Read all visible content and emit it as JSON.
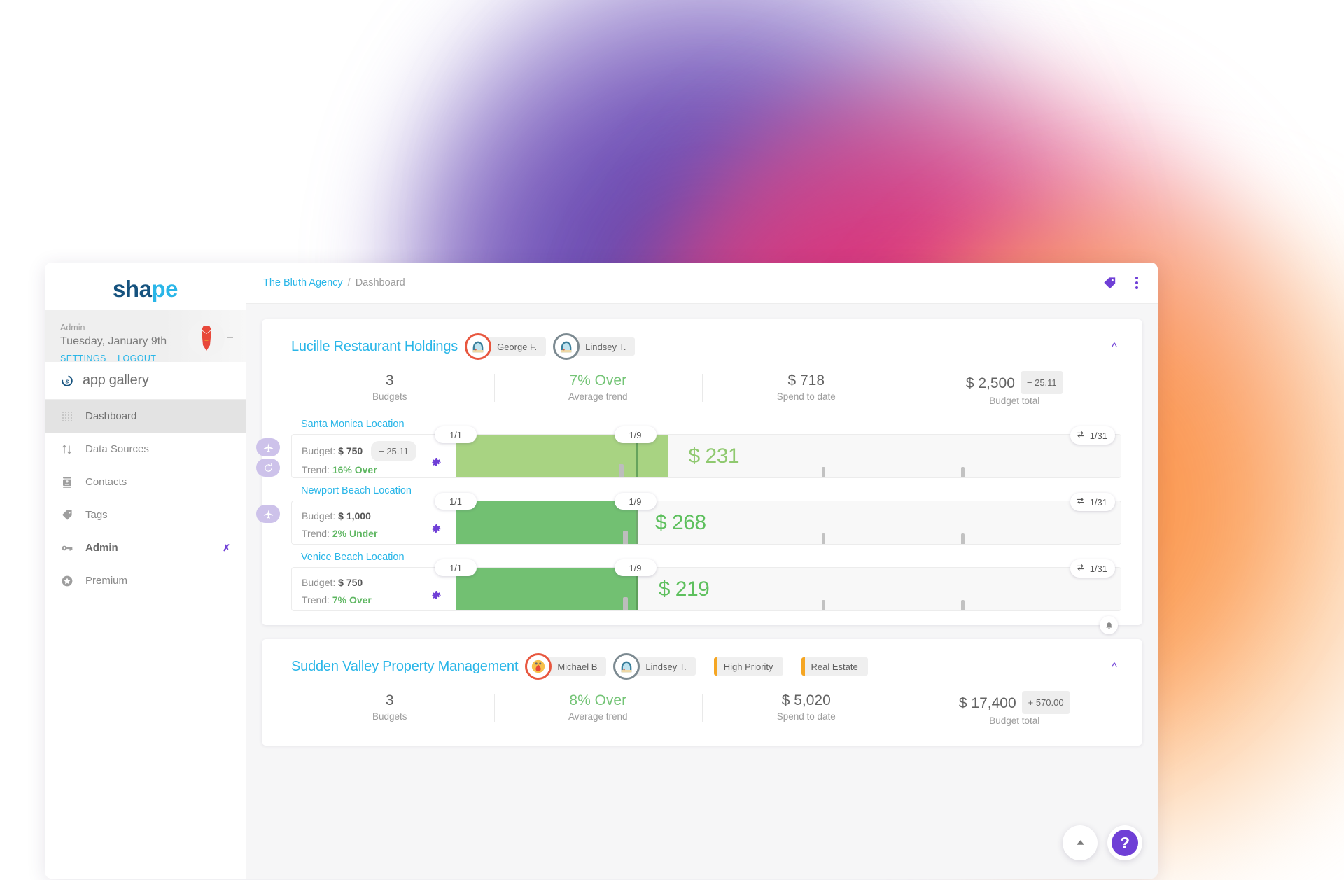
{
  "sidebar": {
    "logo": {
      "part1": "sh",
      "part2": "a",
      "part3": "pe"
    },
    "user": {
      "role": "Admin",
      "date": "Tuesday, January 9th",
      "settings_label": "SETTINGS",
      "logout_label": "LOGOUT",
      "avatar_icon": "necktie-avatar-icon"
    },
    "gallery": {
      "label": "app gallery",
      "icon": "shape-s-icon"
    },
    "items": [
      {
        "label": "Dashboard",
        "icon": "grid-dots-icon",
        "active": true,
        "bold": false,
        "chevron": false
      },
      {
        "label": "Data Sources",
        "icon": "sort-arrows-icon",
        "active": false,
        "bold": false,
        "chevron": false
      },
      {
        "label": "Contacts",
        "icon": "contact-card-icon",
        "active": false,
        "bold": false,
        "chevron": false
      },
      {
        "label": "Tags",
        "icon": "tag-icon",
        "active": false,
        "bold": false,
        "chevron": false
      },
      {
        "label": "Admin",
        "icon": "key-icon",
        "active": false,
        "bold": true,
        "chevron": true
      },
      {
        "label": "Premium",
        "icon": "star-circle-icon",
        "active": false,
        "bold": false,
        "chevron": false
      }
    ]
  },
  "topbar": {
    "breadcrumb_link": "The Bluth Agency",
    "breadcrumb_sep": "/",
    "breadcrumb_current": "Dashboard",
    "tag_icon": "tag-icon",
    "menu_icon": "kebab-menu-icon"
  },
  "colors": {
    "accent_blue": "#29b6e8",
    "accent_purple": "#6f3fd6",
    "green": "#74c476",
    "bar_light": "#a8d382",
    "bar_mid": "#72c072",
    "tag_orange": "#f5a623"
  },
  "cards": [
    {
      "title": "Lucille Restaurant Holdings",
      "collapse_icon": "chevron-up-icon",
      "people": [
        {
          "name": "George F.",
          "ring": "ring-red"
        },
        {
          "name": "Lindsey T.",
          "ring": "ring-grey"
        }
      ],
      "tags": [],
      "stats": [
        {
          "value": "3",
          "label": "Budgets",
          "green": false,
          "delta": ""
        },
        {
          "value": "7% Over",
          "label": "Average trend",
          "green": true,
          "delta": ""
        },
        {
          "value": "$ 718",
          "label": "Spend to date",
          "green": false,
          "delta": ""
        },
        {
          "value": "$ 2,500",
          "label": "Budget total",
          "green": false,
          "delta": "− 25.11"
        }
      ],
      "rows": [
        {
          "title": "Santa Monica Location",
          "budget_label": "Budget:",
          "budget_value": "$ 750",
          "budget_delta": "− 25.11",
          "trend_label": "Trend:",
          "trend_value": "16% Over",
          "amount": "$ 231",
          "start_pill": "1/1",
          "today_pill": "1/9",
          "end_pill": "1/31",
          "side_buttons": [
            "airplane-icon",
            "refresh-icon"
          ],
          "fill_pct": 32,
          "marker_pct": 27,
          "nub_pct": 24.5,
          "bar_tone": "light",
          "gear_icon": "gear-icon",
          "repeat_icon": "repeat-icon",
          "bell": false
        },
        {
          "title": "Newport Beach Location",
          "budget_label": "Budget:",
          "budget_value": "$ 1,000",
          "budget_delta": "",
          "trend_label": "Trend:",
          "trend_value": "2% Under",
          "amount": "$ 268",
          "start_pill": "1/1",
          "today_pill": "1/9",
          "end_pill": "1/31",
          "side_buttons": [
            "airplane-icon"
          ],
          "fill_pct": 27,
          "marker_pct": 27,
          "nub_pct": 25.2,
          "bar_tone": "mid",
          "gear_icon": "gear-icon",
          "repeat_icon": "repeat-icon",
          "bell": false
        },
        {
          "title": "Venice Beach Location",
          "budget_label": "Budget:",
          "budget_value": "$ 750",
          "budget_delta": "",
          "trend_label": "Trend:",
          "trend_value": "7% Over",
          "amount": "$ 219",
          "start_pill": "1/1",
          "today_pill": "1/9",
          "end_pill": "1/31",
          "side_buttons": [],
          "fill_pct": 27.5,
          "marker_pct": 27,
          "nub_pct": 25.2,
          "bar_tone": "mid",
          "gear_icon": "gear-icon",
          "repeat_icon": "repeat-icon",
          "bell": true
        }
      ]
    },
    {
      "title": "Sudden Valley Property Management",
      "collapse_icon": "chevron-up-icon",
      "people": [
        {
          "name": "Michael B",
          "ring": "ring-red"
        },
        {
          "name": "Lindsey T.",
          "ring": "ring-grey"
        }
      ],
      "tags": [
        "High Priority",
        "Real Estate"
      ],
      "stats": [
        {
          "value": "3",
          "label": "Budgets",
          "green": false,
          "delta": ""
        },
        {
          "value": "8% Over",
          "label": "Average trend",
          "green": true,
          "delta": ""
        },
        {
          "value": "$ 5,020",
          "label": "Spend to date",
          "green": false,
          "delta": ""
        },
        {
          "value": "$ 17,400",
          "label": "Budget total",
          "green": false,
          "delta": "+ 570.00"
        }
      ],
      "rows": []
    }
  ],
  "fab": {
    "scroll_top_icon": "caret-up-icon",
    "help_label": "?",
    "help_icon": "help-circle-icon"
  }
}
